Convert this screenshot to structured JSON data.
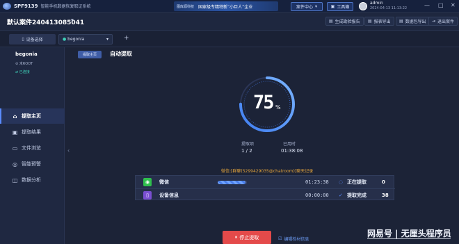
{
  "titlebar": {
    "app_title": "SPF9139",
    "app_subtitle": "智能手机数据恢复取证系统",
    "banner_badge": "图库源科技",
    "banner_text": "国家级专精特新“小巨人”企业",
    "case_center_label": "案件中心",
    "workbench_label": "工具箱",
    "user_name": "admin",
    "user_time": "2024-04-13 11:13:22",
    "window_controls": [
      "—",
      "□",
      "✕"
    ]
  },
  "casebar": {
    "case_title": "默认案件240413085041",
    "buttons": [
      "生成勘验报告",
      "报表导出",
      "数据包导出",
      "退出案件"
    ]
  },
  "devbar": {
    "select_device_label": "设备选择",
    "selected_device": "begonia",
    "add_symbol": "+"
  },
  "sidebar": {
    "device_name": "begonia",
    "device_root": "未ROOT",
    "device_status": "已连接",
    "nav": [
      {
        "label": "提取主页",
        "icon": "home-icon",
        "active": true
      },
      {
        "label": "提取结果",
        "icon": "result-icon",
        "active": false
      },
      {
        "label": "文件浏览",
        "icon": "folder-icon",
        "active": false
      },
      {
        "label": "智能预警",
        "icon": "alert-icon",
        "active": false
      },
      {
        "label": "数据分析",
        "icon": "analysis-icon",
        "active": false
      }
    ]
  },
  "main": {
    "tab_label": "提取主页",
    "title": "自动提取",
    "progress_percent": 75,
    "percent_sign": "%",
    "items_label": "提取项",
    "items_value": "1 / 2",
    "elapsed_label": "已用时",
    "elapsed_value": "01:38:08",
    "current_item": "微信:[群聊(5299429035@chatroom)]聊天记录",
    "rows": [
      {
        "name": "微信",
        "icon_color": "#2fbf4d",
        "progress": 0.95,
        "time": "01:23:38",
        "status": "正在提取",
        "status_icon": "spinner-icon",
        "count": "0"
      },
      {
        "name": "设备信息",
        "icon_color": "#7a4fd1",
        "progress": null,
        "time": "00:00:00",
        "status": "提取完成",
        "status_icon": "check-icon",
        "count": "38"
      }
    ],
    "stop_label": "停止提取",
    "edit_info_label": "编辑检材信息"
  },
  "watermark": "网易号 | 无厘头程序员",
  "colors": {
    "accent": "#5a8bff",
    "ring_start": "#3f7df0",
    "ring_end": "#7ab4ff",
    "warning": "#e0a23c",
    "stop": "#e44a4a"
  }
}
